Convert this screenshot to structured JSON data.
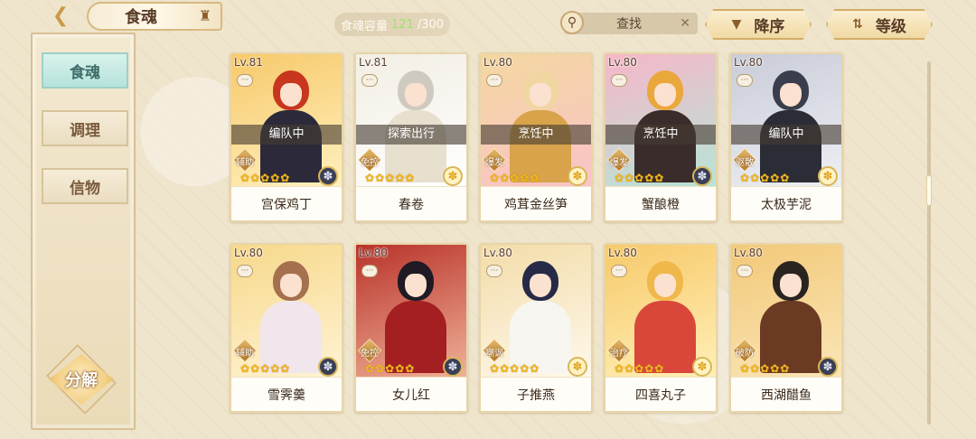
{
  "header": {
    "title": "食魂",
    "capacity_label": "食魂容量",
    "capacity_current": "121",
    "capacity_max": "/300",
    "search_placeholder": "查找",
    "sort_label": "降序",
    "filter_label": "等级"
  },
  "sidebar": {
    "tabs": [
      {
        "label": "食魂",
        "active": true
      },
      {
        "label": "调理",
        "active": false
      },
      {
        "label": "信物",
        "active": false
      }
    ],
    "decompose_label": "分解"
  },
  "cards": [
    {
      "level": "Lv.81",
      "status": "编队中",
      "role": "辅助",
      "name": "宫保鸡丁",
      "element": "dark",
      "palette": [
        "#f7c96a",
        "#fff1c0"
      ],
      "hair": "#c8361e",
      "outfit": "#2c2a3a"
    },
    {
      "level": "Lv.81",
      "status": "探索出行",
      "role": "免控",
      "name": "春卷",
      "element": "light",
      "palette": [
        "#f2eee4",
        "#ffffff"
      ],
      "hair": "#cfcac0",
      "outfit": "#e7e0cf"
    },
    {
      "level": "Lv.80",
      "status": "烹饪中",
      "role": "爆发",
      "name": "鸡茸金丝笋",
      "element": "light",
      "palette": [
        "#f4d7a0",
        "#f9c3c8"
      ],
      "hair": "#f0d7a2",
      "outfit": "#d8a34b"
    },
    {
      "level": "Lv.80",
      "status": "烹饪中",
      "role": "爆发",
      "name": "蟹酿橙",
      "element": "dark",
      "palette": [
        "#f6b6c8",
        "#b5e6d8"
      ],
      "hair": "#e9a73c",
      "outfit": "#3a2c2a"
    },
    {
      "level": "Lv.80",
      "status": "编队中",
      "role": "驱散",
      "name": "太极芋泥",
      "element": "light",
      "palette": [
        "#c9ccd8",
        "#eef0f4"
      ],
      "hair": "#3a3d4c",
      "outfit": "#2a2c36"
    },
    {
      "level": "Lv.80",
      "status": "",
      "role": "辅助",
      "name": "雪霁羹",
      "element": "dark",
      "palette": [
        "#f7d88a",
        "#fff4d6"
      ],
      "hair": "#a5704d",
      "outfit": "#f1e6ec"
    },
    {
      "level": "Lv.80",
      "status": "",
      "role": "免控",
      "name": "女儿红",
      "element": "dark",
      "palette": [
        "#b8322a",
        "#f1b49a"
      ],
      "hair": "#1f1a24",
      "outfit": "#a41f22"
    },
    {
      "level": "Lv.80",
      "status": "",
      "role": "嘲讽",
      "name": "子推燕",
      "element": "light",
      "palette": [
        "#f2dca8",
        "#fff8ec"
      ],
      "hair": "#262a48",
      "outfit": "#f7f5f0"
    },
    {
      "level": "Lv.80",
      "status": "",
      "role": "治疗",
      "name": "四喜丸子",
      "element": "light",
      "palette": [
        "#f7c96a",
        "#fff0b8"
      ],
      "hair": "#f0b74a",
      "outfit": "#d9473a"
    },
    {
      "level": "Lv.80",
      "status": "",
      "role": "破防",
      "name": "西湖醋鱼",
      "element": "dark",
      "palette": [
        "#f2c878",
        "#fbe6b8"
      ],
      "hair": "#2a2420",
      "outfit": "#6b3a22"
    }
  ],
  "icons": {
    "back": "chevron-left-icon",
    "title_decor": "crown-icon",
    "search": "magnifier-icon",
    "clear": "close-icon",
    "sort": "triangle-down-icon",
    "filter": "sort-arrows-icon",
    "chat": "speech-bubble-icon",
    "element_dark": "dark-flower-icon",
    "element_light": "gold-flower-icon"
  },
  "colors": {
    "accent_teal": "#b6e2dc",
    "gold": "#d3ad66",
    "capacity_green": "#9ee36a"
  }
}
